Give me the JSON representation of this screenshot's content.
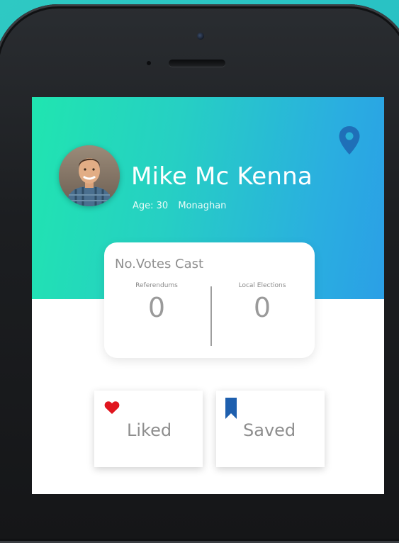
{
  "profile": {
    "name": "Mike Mc Kenna",
    "age_text": "Age: 30",
    "location": "Monaghan"
  },
  "votes": {
    "title": "No.Votes Cast",
    "referendums_label": "Referendums",
    "referendums_value": "0",
    "local_label": "Local Elections",
    "local_value": "0"
  },
  "actions": {
    "liked_label": "Liked",
    "saved_label": "Saved"
  },
  "icons": {
    "location": "location-pin-icon",
    "liked": "heart-icon",
    "saved": "bookmark-icon"
  },
  "colors": {
    "header_start": "#20e5b0",
    "header_end": "#2b9fe6",
    "pin": "#1f6fb8",
    "heart": "#e0161f",
    "bookmark": "#1e5fae"
  }
}
